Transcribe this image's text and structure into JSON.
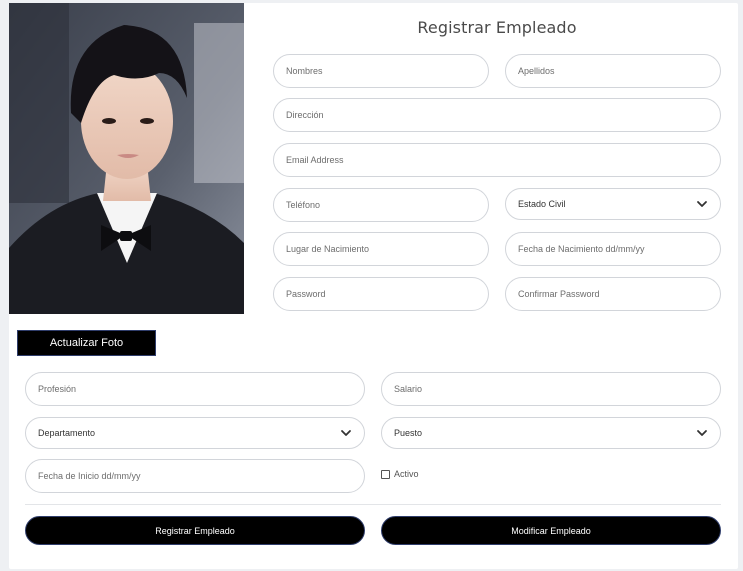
{
  "form": {
    "title": "Registrar Empleado",
    "nombres_placeholder": "Nombres",
    "apellidos_placeholder": "Apellidos",
    "direccion_placeholder": "Dirección",
    "email_placeholder": "Email Address",
    "telefono_placeholder": "Teléfono",
    "estado_civil_value": "Estado Civil",
    "lugar_nacimiento_placeholder": "Lugar de Nacimiento",
    "fecha_nacimiento_placeholder": "Fecha de Nacimiento dd/mm/yy",
    "password_placeholder": "Password",
    "confirmar_password_placeholder": "Confirmar Password",
    "profesion_placeholder": "Profesión",
    "salario_placeholder": "Salario",
    "departamento_value": "Departamento",
    "puesto_value": "Puesto",
    "fecha_inicio_placeholder": "Fecha de Inicio dd/mm/yy",
    "activo_label": "Activo"
  },
  "buttons": {
    "actualizar_foto": "Actualizar Foto",
    "registrar": "Registrar Empleado",
    "modificar": "Modificar Empleado"
  },
  "icons": {
    "select_chevron": "chevron-down-icon"
  },
  "colors": {
    "button_bg": "#000000",
    "button_border": "#2f3d6b",
    "field_border": "#d2d5da"
  }
}
